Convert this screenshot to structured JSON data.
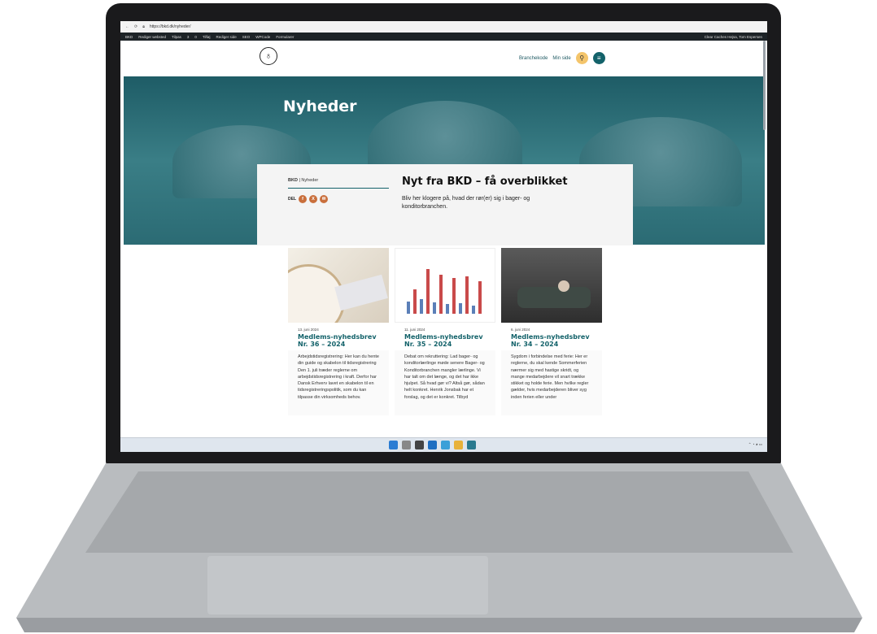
{
  "browser": {
    "url": "https://bkd.dk/nyheder/"
  },
  "adminbar": {
    "items": [
      "BKD",
      "Rediger websted",
      "Tilpas",
      "3",
      "0",
      "Tilføj",
      "Rediger side",
      "SEO",
      "WPCode",
      "Formularer"
    ],
    "right": "Clear Caches   Hejsa, Tom Espersen"
  },
  "header": {
    "branchekode": "Branchekode",
    "min_side": "Min side"
  },
  "hero": {
    "title": "Nyheder"
  },
  "intro": {
    "crumb_home": "BKD",
    "crumb_sep": "|",
    "crumb_current": "Nyheder",
    "share_label": "DEL",
    "share_icons": [
      "facebook-icon",
      "x-icon",
      "mail-icon"
    ],
    "title": "Nyt fra BKD – få overblikket",
    "text": "Bliv her klogere på, hvad der rør(er) sig i bager- og konditorbranchen."
  },
  "articles": [
    {
      "date": "13. juni 2024",
      "title": "Medlems-nyhedsbrev Nr. 36 – 2024",
      "body": "Arbejdstidsregistrering: Her kan du hente din guide og skabelon til tidsregistrering Den 1. juli træder reglerne om arbejdstidsregistrering i kraft. Derfor har Dansk Erhverv lavet en skabelon til en tidsregistreringspolitik, som du kan tilpasse din virksomheds behov."
    },
    {
      "date": "11. juni 2024",
      "title": "Medlems-nyhedsbrev Nr. 35 – 2024",
      "body": "Debat om rekruttering: Lad bager- og konditorlærlinge møde senere Bager- og Konditorbranchen mangler lærlinge. Vi har talt om det længe, og det har ikke hjulpet. Så hvad gør vi? Altså gør, sådan helt konkret. Henrik Jonsbak har et forslag, og det er konkret. Tilbyd"
    },
    {
      "date": "6. juni 2024",
      "title": "Medlems-nyhedsbrev Nr. 34 – 2024",
      "body": "Sygdom i forbindelse med ferie: Her er reglerne, du skal kende Sommerferien nærmer sig med hastige skridt, og mange medarbejdere vil snart trække stikket og holde ferie. Men hvilke regler gælder, hvis medarbejderen bliver syg inden ferien eller under"
    }
  ],
  "colors": {
    "brand": "#13626a",
    "accent": "#f4c56b",
    "share": "#c96f3c"
  }
}
